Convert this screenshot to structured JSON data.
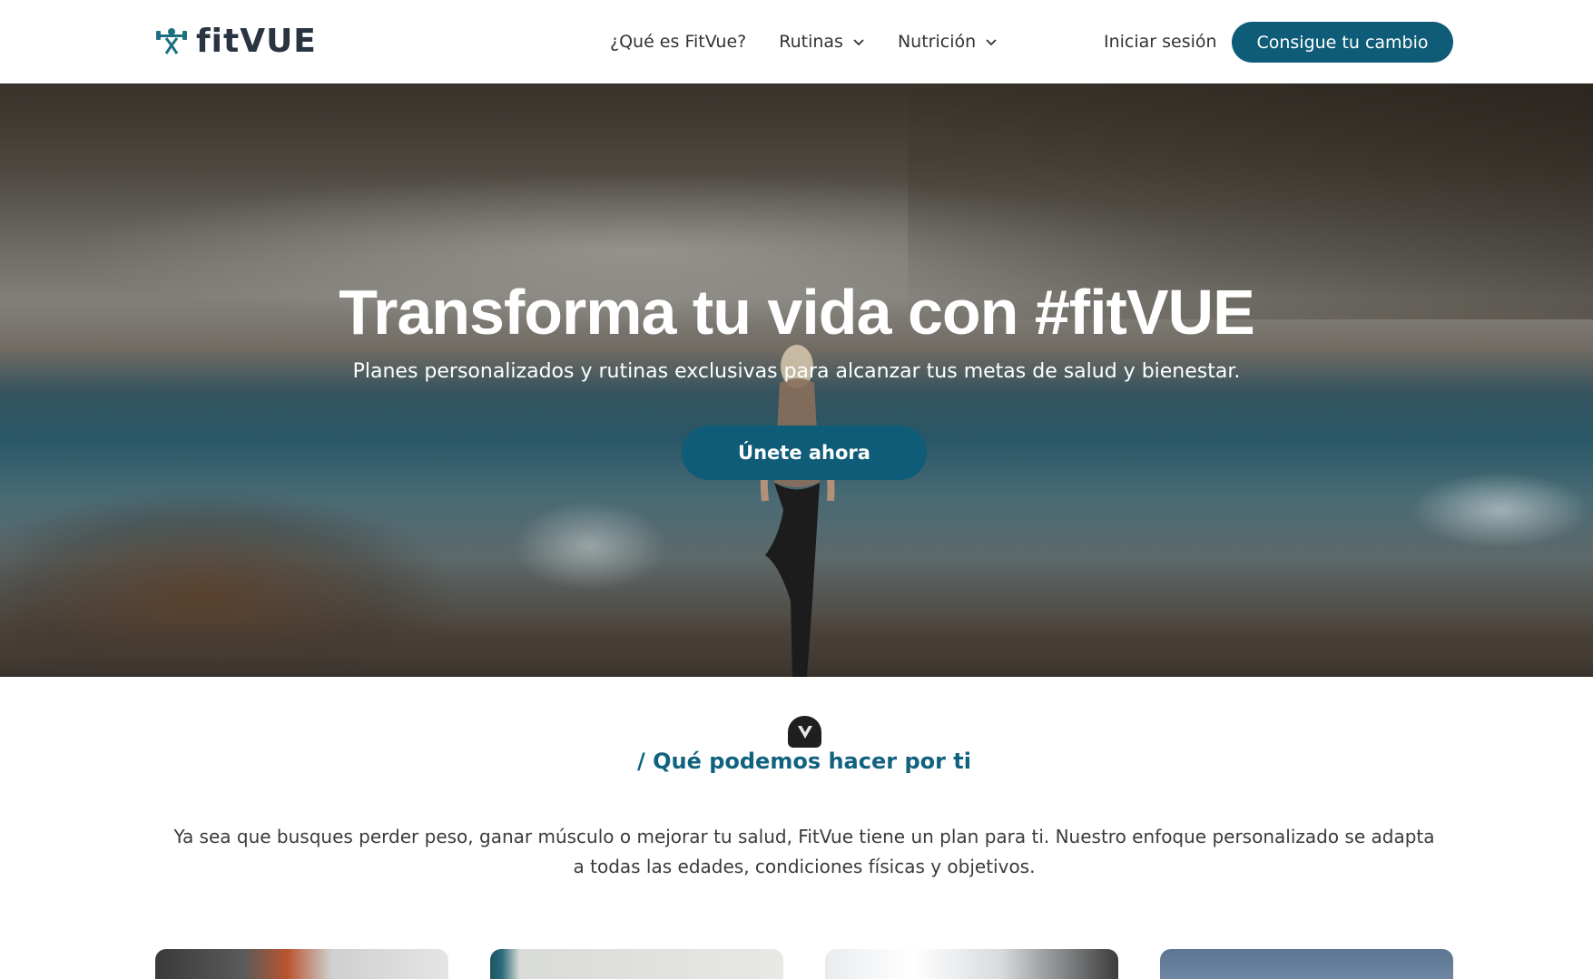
{
  "brand": {
    "name": "fitVUE",
    "accent": "#0f5c78",
    "title_color": "#11627e"
  },
  "nav": {
    "items": [
      {
        "label": "¿Qué es FitVue?",
        "dropdown": false
      },
      {
        "label": "Rutinas",
        "dropdown": true
      },
      {
        "label": "Nutrición",
        "dropdown": true
      }
    ],
    "login_label": "Iniciar sesión",
    "cta_label": "Consigue tu cambio"
  },
  "hero": {
    "title": "Transforma tu vida con #fitVUE",
    "subtitle": "Planes personalizados y rutinas exclusivas para alcanzar tus metas de salud y bienestar.",
    "button_label": "Únete ahora"
  },
  "section": {
    "badge_icon": "vue-v-icon",
    "title": "/ Qué podemos hacer por ti",
    "text": "Ya sea que busques perder peso, ganar músculo o mejorar tu salud, FitVue tiene un plan para ti. Nuestro enfoque personalizado se adapta a todas las edades, condiciones físicas y objetivos."
  }
}
